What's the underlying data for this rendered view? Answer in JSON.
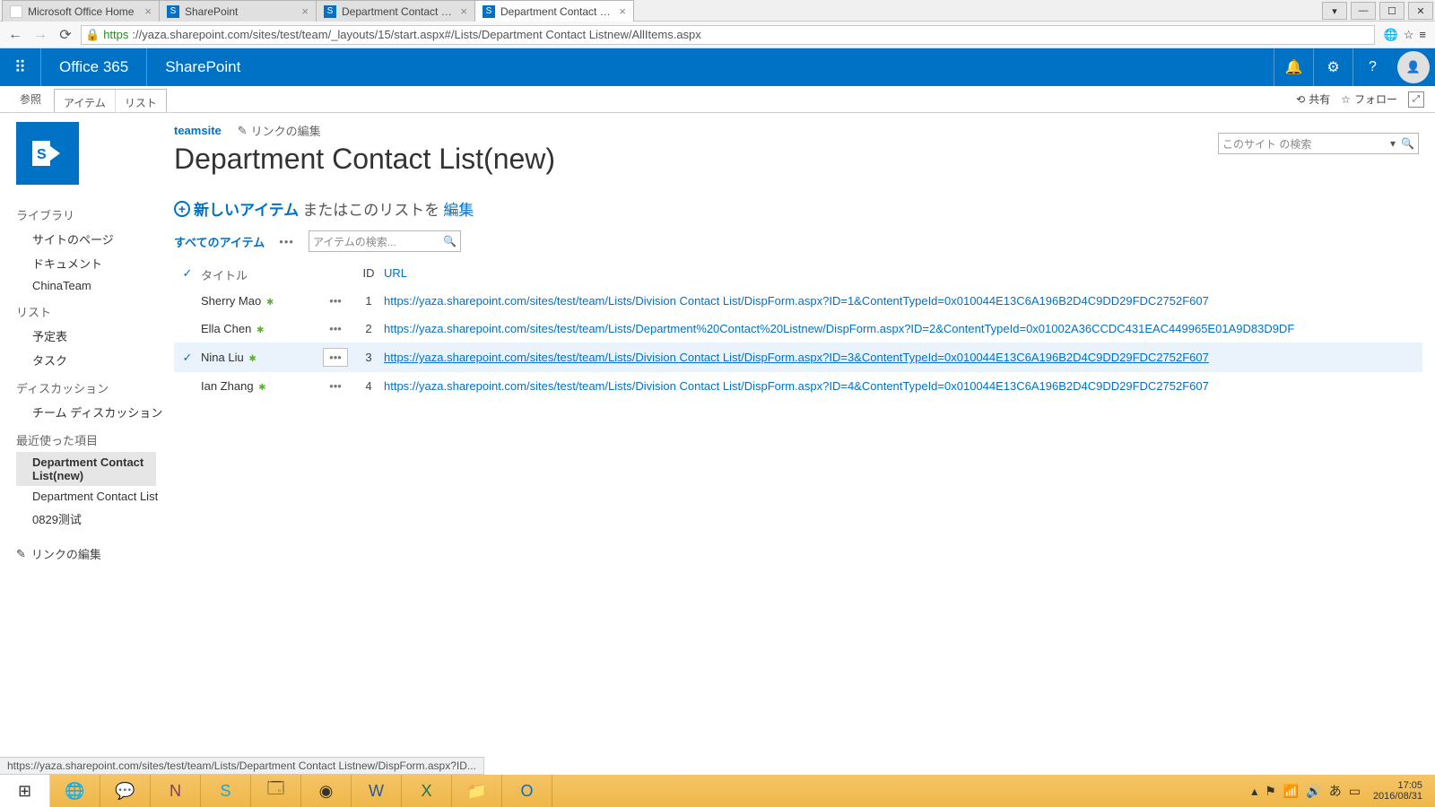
{
  "browser_tabs": [
    {
      "title": "Microsoft Office Home",
      "icon": "office",
      "active": false
    },
    {
      "title": "SharePoint",
      "icon": "sharepoint",
      "active": false
    },
    {
      "title": "Department Contact List(",
      "icon": "sharepoint",
      "active": false
    },
    {
      "title": "Department Contact List(n",
      "icon": "sharepoint",
      "active": true
    }
  ],
  "url": {
    "proto": "https",
    "host_path": "://yaza.sharepoint.com/sites/test/team/_layouts/15/start.aspx#/Lists/Department Contact Listnew/AllItems.aspx"
  },
  "suite": {
    "brand": "Office 365",
    "app": "SharePoint"
  },
  "ribbon": {
    "browse": "参照",
    "items": "アイテム",
    "list": "リスト",
    "share": "共有",
    "follow": "フォロー"
  },
  "crumbs": {
    "site": "teamsite",
    "edit_links": "リンクの編集"
  },
  "page_title": "Department Contact List(new)",
  "site_search_placeholder": "このサイト の検索",
  "newitem": {
    "new": "新しいアイテム",
    "or": "またはこのリストを",
    "edit": "編集"
  },
  "viewbar": {
    "view": "すべてのアイテム",
    "find_placeholder": "アイテムの検索..."
  },
  "columns": {
    "title": "タイトル",
    "id": "ID",
    "url": "URL"
  },
  "rows": [
    {
      "title": "Sherry Mao",
      "new": true,
      "id": "1",
      "url": "https://yaza.sharepoint.com/sites/test/team/Lists/Division Contact List/DispForm.aspx?ID=1&ContentTypeId=0x010044E13C6A196B2D4C9DD29FDC2752F607",
      "hover": false,
      "break": false
    },
    {
      "title": "Ella Chen",
      "new": true,
      "id": "2",
      "url": "https://yaza.sharepoint.com/sites/test/team/Lists/Department%20Contact%20Listnew/DispForm.aspx?ID=2&ContentTypeId=0x01002A36CCDC431EAC449965E01A9D83D9DF",
      "hover": false,
      "break": true
    },
    {
      "title": "Nina Liu",
      "new": true,
      "id": "3",
      "url": "https://yaza.sharepoint.com/sites/test/team/Lists/Division Contact List/DispForm.aspx?ID=3&ContentTypeId=0x010044E13C6A196B2D4C9DD29FDC2752F607",
      "hover": true,
      "break": false
    },
    {
      "title": "Ian Zhang",
      "new": true,
      "id": "4",
      "url": "https://yaza.sharepoint.com/sites/test/team/Lists/Division Contact List/DispForm.aspx?ID=4&ContentTypeId=0x010044E13C6A196B2D4C9DD29FDC2752F607",
      "hover": false,
      "break": false
    }
  ],
  "leftnav": {
    "library": "ライブラリ",
    "library_items": [
      "サイトのページ",
      "ドキュメント",
      "ChinaTeam"
    ],
    "list": "リスト",
    "list_items": [
      "予定表",
      "タスク"
    ],
    "disc": "ディスカッション",
    "disc_items": [
      "チーム ディスカッション"
    ],
    "recent": "最近使った項目",
    "recent_items": [
      "Department Contact List(new)",
      "Department Contact List",
      "0829测试"
    ],
    "recent_selected": 0,
    "edit_links": "リンクの編集"
  },
  "status_link": "https://yaza.sharepoint.com/sites/test/team/Lists/Department Contact Listnew/DispForm.aspx?ID...",
  "clock": {
    "time": "17:05",
    "date": "2016/08/31"
  }
}
